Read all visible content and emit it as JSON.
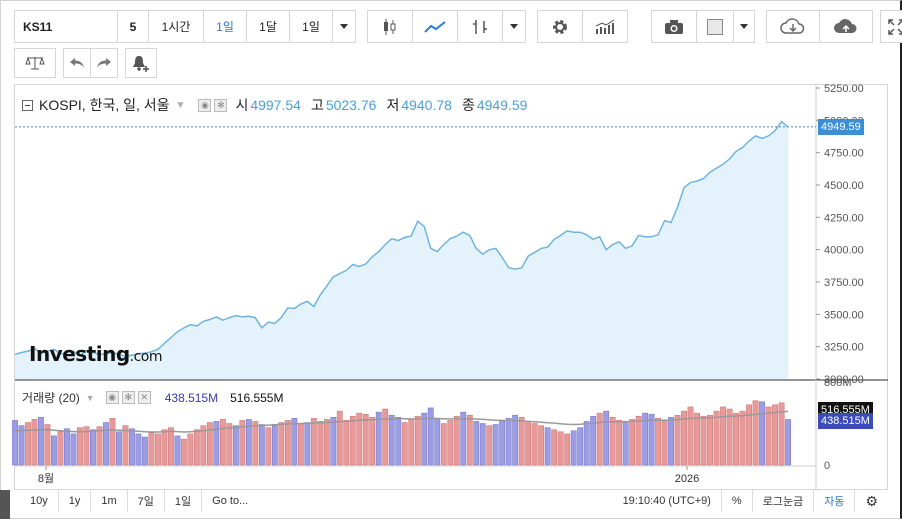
{
  "toolbar": {
    "symbol": "KS11",
    "interval_5": "5",
    "interval_1h": "1시간",
    "interval_1d": "1일",
    "interval_1mo": "1달",
    "interval_select": "1일"
  },
  "legend": {
    "title": "KOSPI, 한국, 일, 서울",
    "open_label": "시",
    "open_value": "4997.54",
    "high_label": "고",
    "high_value": "5023.76",
    "low_label": "저",
    "low_value": "4940.78",
    "close_label": "종",
    "close_value": "4949.59"
  },
  "volume_legend": {
    "title": "거래량 (20)",
    "value1": "438.515M",
    "value2": "516.555M"
  },
  "logo": {
    "main": "Investing",
    "suffix": ".com"
  },
  "price_axis": {
    "ticks": [
      "5250.00",
      "5000.00",
      "4750.00",
      "4500.00",
      "4250.00",
      "4000.00",
      "3750.00",
      "3500.00",
      "3250.00",
      "3000.00"
    ],
    "last_price": "4949.59",
    "vol_ticks": [
      "800M",
      "0"
    ],
    "vol_tag1": "516.555M",
    "vol_tag2": "438.515M"
  },
  "time_axis": {
    "labels": [
      "8월",
      "2026"
    ]
  },
  "bottom": {
    "range_10y": "10y",
    "range_1y": "1y",
    "range_1m": "1m",
    "range_7d": "7일",
    "range_1d": "1일",
    "goto": "Go to...",
    "clock": "19:10:40 (UTC+9)",
    "percent": "%",
    "log": "로그눈금",
    "auto": "자동"
  },
  "colors": {
    "line": "#6fb3e0",
    "area": "#e4f3fb",
    "vol_up": "#e89a9a",
    "vol_down": "#9d9de3",
    "ma": "#999999",
    "price_tag": "#3b8fd6",
    "vol_tag2": "#3b4cb8",
    "vol_tag1": "#111111"
  },
  "chart_data": {
    "type": "line",
    "ylim": [
      3000,
      5250
    ],
    "close": [
      3190,
      3205,
      3215,
      3235,
      3200,
      3215,
      3230,
      3195,
      3205,
      3215,
      3180,
      3220,
      3205,
      3190,
      3195,
      3205,
      3190,
      3175,
      3185,
      3195,
      3200,
      3210,
      3230,
      3275,
      3320,
      3365,
      3395,
      3420,
      3410,
      3445,
      3460,
      3480,
      3455,
      3475,
      3490,
      3480,
      3485,
      3475,
      3395,
      3440,
      3430,
      3475,
      3550,
      3545,
      3580,
      3600,
      3560,
      3650,
      3720,
      3790,
      3815,
      3840,
      3885,
      3870,
      3890,
      3945,
      3985,
      4040,
      4085,
      4070,
      4095,
      4105,
      4220,
      4180,
      4010,
      3985,
      4040,
      4085,
      4105,
      4135,
      4110,
      4010,
      3965,
      4000,
      4010,
      3940,
      3860,
      3850,
      3860,
      3950,
      3980,
      4010,
      4020,
      4080,
      4110,
      4145,
      4135,
      4135,
      4115,
      4080,
      4100,
      4000,
      4040,
      4060,
      4010,
      4030,
      4110,
      4100,
      4100,
      4115,
      4225,
      4210,
      4330,
      4480,
      4520,
      4530,
      4550,
      4600,
      4630,
      4660,
      4700,
      4760,
      4790,
      4840,
      4880,
      4860,
      4880,
      4920,
      4990,
      4949.59
    ],
    "volume_ylim": [
      0,
      800
    ],
    "volume": [
      430,
      380,
      410,
      440,
      460,
      390,
      280,
      320,
      350,
      300,
      360,
      370,
      340,
      370,
      410,
      450,
      320,
      380,
      350,
      300,
      270,
      310,
      300,
      340,
      360,
      280,
      250,
      300,
      340,
      380,
      410,
      420,
      440,
      400,
      380,
      430,
      440,
      420,
      390,
      360,
      380,
      410,
      430,
      450,
      400,
      410,
      450,
      420,
      440,
      460,
      520,
      430,
      470,
      500,
      490,
      460,
      510,
      540,
      480,
      460,
      410,
      440,
      470,
      500,
      550,
      450,
      400,
      430,
      470,
      510,
      480,
      420,
      400,
      380,
      390,
      420,
      450,
      480,
      460,
      420,
      400,
      380,
      360,
      340,
      320,
      300,
      330,
      360,
      420,
      470,
      500,
      520,
      460,
      430,
      410,
      440,
      470,
      500,
      490,
      450,
      420,
      460,
      480,
      520,
      560,
      500,
      470,
      480,
      520,
      560,
      540,
      500,
      520,
      580,
      620,
      610,
      560,
      580,
      600,
      438.515
    ],
    "volume_up": [
      0,
      0,
      1,
      1,
      0,
      1,
      0,
      1,
      0,
      0,
      1,
      1,
      0,
      1,
      0,
      1,
      0,
      1,
      0,
      0,
      0,
      1,
      1,
      1,
      1,
      0,
      1,
      1,
      1,
      1,
      1,
      0,
      1,
      1,
      0,
      1,
      0,
      1,
      0,
      1,
      0,
      1,
      1,
      0,
      1,
      0,
      1,
      1,
      1,
      0,
      1,
      1,
      1,
      1,
      1,
      1,
      0,
      1,
      0,
      0,
      1,
      1,
      1,
      0,
      0,
      0,
      1,
      1,
      1,
      0,
      1,
      0,
      0,
      1,
      0,
      0,
      0,
      0,
      1,
      1,
      1,
      1,
      0,
      1,
      1,
      1,
      0,
      0,
      0,
      0,
      1,
      0,
      1,
      1,
      0,
      1,
      1,
      0,
      0,
      1,
      1,
      0,
      1,
      1,
      1,
      1,
      1,
      1,
      1,
      1,
      1,
      1,
      1,
      1,
      1,
      0,
      1,
      1,
      1,
      0
    ],
    "volume_ma": [
      330,
      332,
      335,
      338,
      340,
      342,
      335,
      330,
      325,
      322,
      320,
      322,
      325,
      330,
      335,
      338,
      335,
      333,
      330,
      325,
      320,
      318,
      318,
      320,
      325,
      322,
      318,
      320,
      325,
      330,
      338,
      345,
      352,
      358,
      362,
      368,
      372,
      378,
      382,
      385,
      388,
      392,
      395,
      398,
      400,
      403,
      405,
      408,
      410,
      412,
      418,
      422,
      426,
      430,
      434,
      436,
      440,
      444,
      446,
      448,
      446,
      444,
      445,
      448,
      450,
      448,
      446,
      444,
      444,
      446,
      445,
      443,
      440,
      436,
      432,
      430,
      428,
      426,
      424,
      420,
      416,
      412,
      408,
      404,
      398,
      392,
      390,
      392,
      398,
      404,
      410,
      414,
      416,
      418,
      418,
      420,
      424,
      428,
      430,
      432,
      432,
      434,
      438,
      442,
      448,
      452,
      454,
      456,
      460,
      466,
      470,
      472,
      476,
      482,
      488,
      494,
      500,
      506,
      512,
      516.555
    ]
  }
}
